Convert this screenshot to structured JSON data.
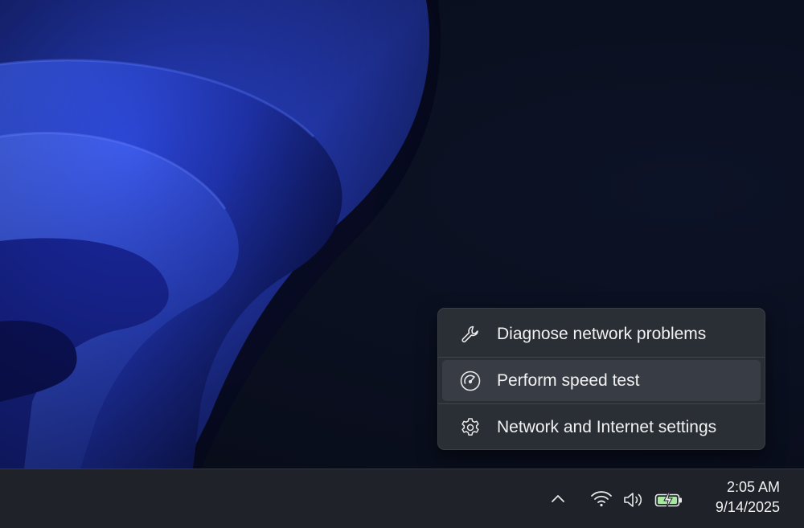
{
  "context_menu": {
    "items": [
      {
        "label": "Diagnose network problems",
        "icon": "wrench-icon"
      },
      {
        "label": "Perform speed test",
        "icon": "speedometer-icon"
      },
      {
        "label": "Network and Internet settings",
        "icon": "gear-icon"
      }
    ],
    "hovered_item": "Perform speed test"
  },
  "taskbar": {
    "tray": {
      "overflow_icon": "chevron-up-icon",
      "wifi_icon": "wifi-icon",
      "volume_icon": "volume-icon",
      "battery_icon": "battery-charging-icon"
    },
    "clock": {
      "time": "2:05 AM",
      "date": "9/14/2025"
    }
  },
  "colors": {
    "menu_background": "#2a2e35",
    "menu_hover": "#383c44",
    "taskbar_background": "#1f2229",
    "battery_fill": "#a8e6a1",
    "text": "#f2f2f2"
  }
}
